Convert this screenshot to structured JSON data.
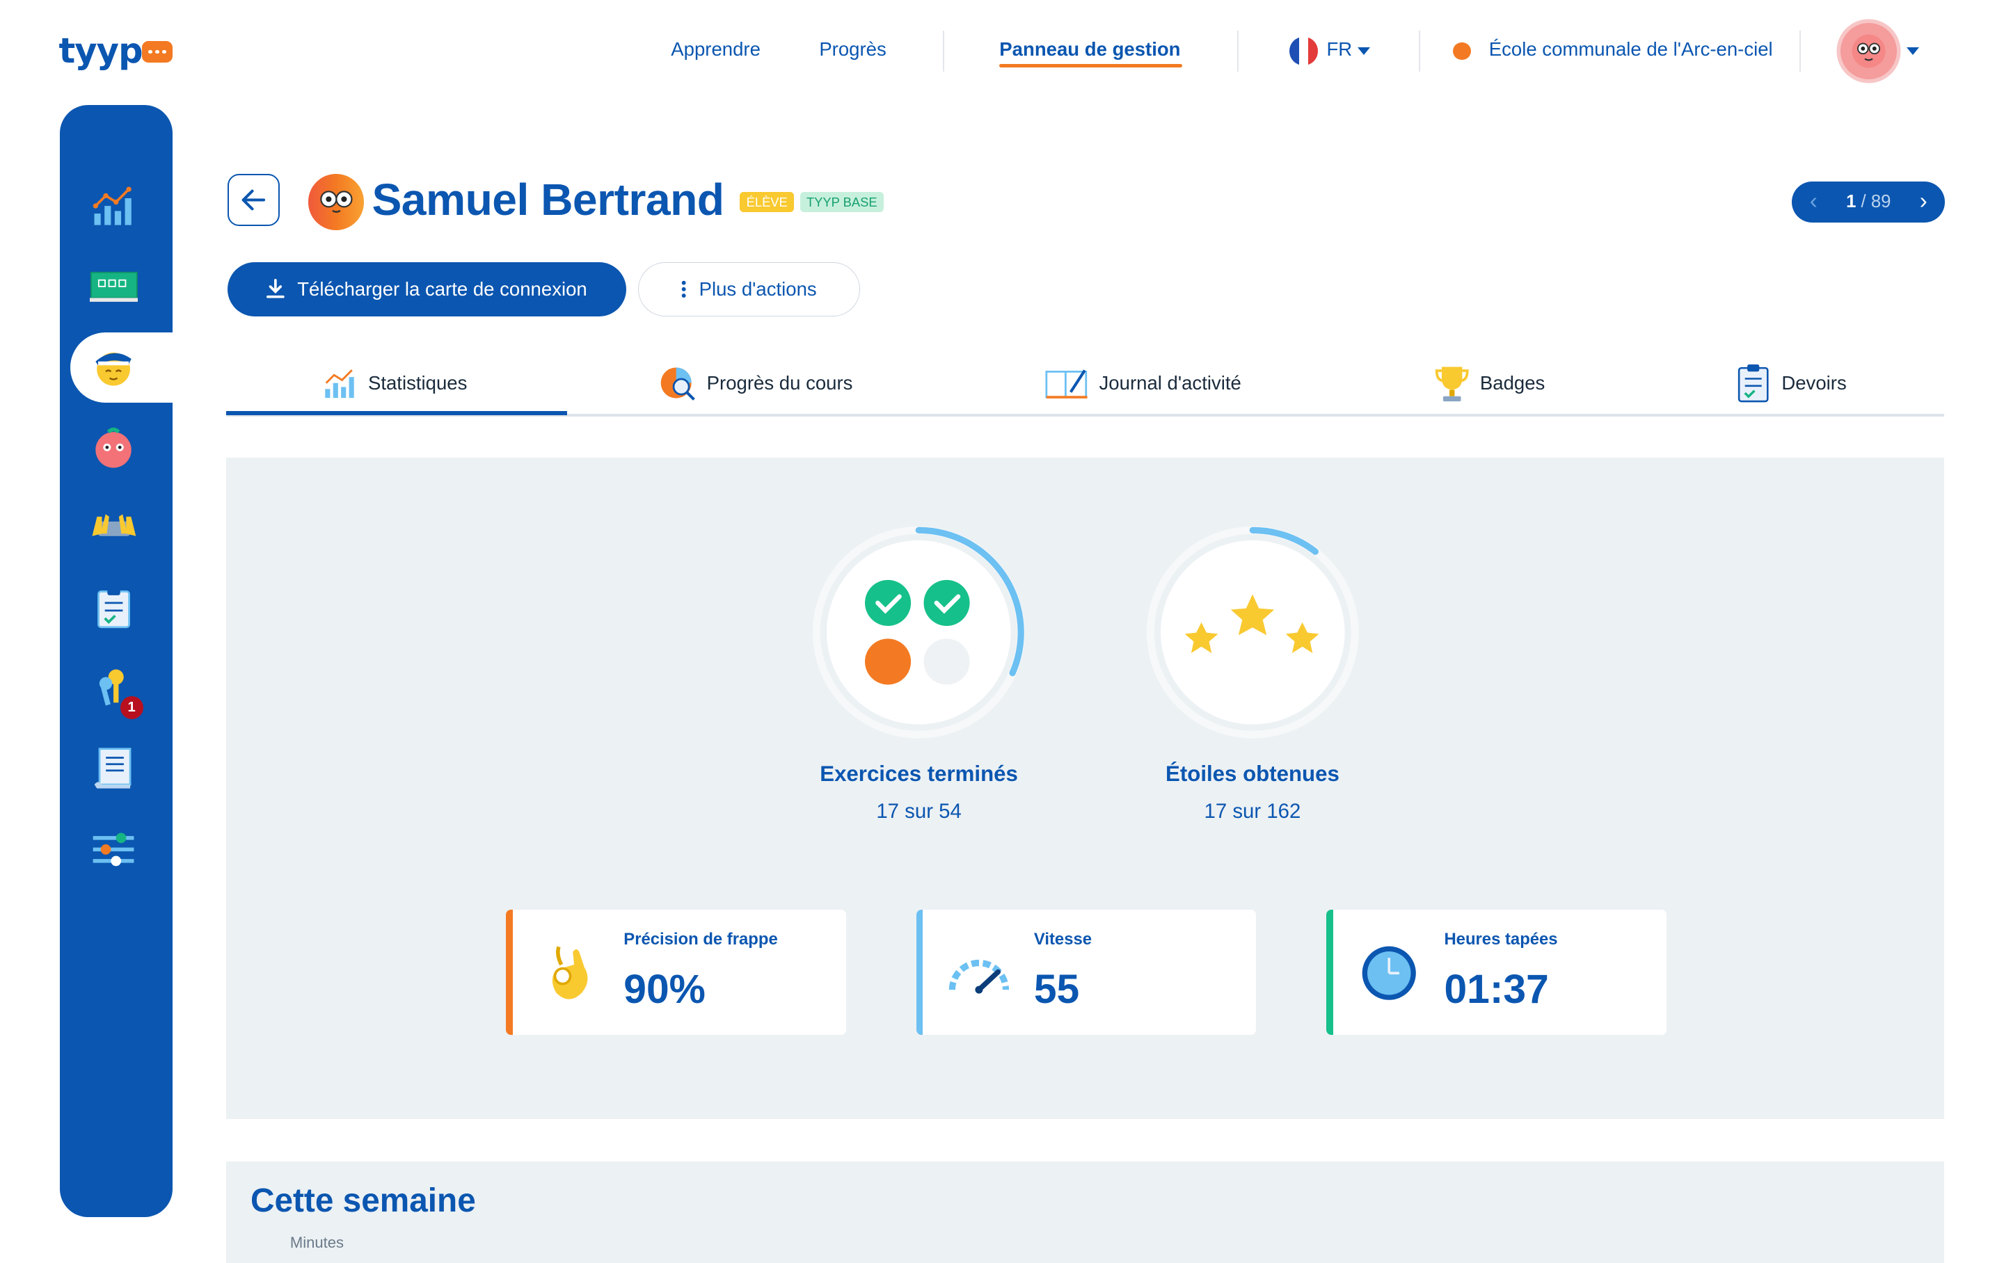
{
  "brand": {
    "logo": "tyyp"
  },
  "nav": {
    "learn": "Apprendre",
    "progress": "Progrès",
    "dashboard": "Panneau de gestion",
    "language": "FR",
    "school": "École communale de l'Arc-en-ciel"
  },
  "student": {
    "name": "Samuel Bertrand",
    "role_tag": "ÉLÈVE",
    "plan_tag": "TYYP BASE"
  },
  "pager": {
    "current": "1",
    "total": "/ 89"
  },
  "actions": {
    "download": "Télécharger la carte de connexion",
    "more": "Plus d'actions"
  },
  "tabs": [
    {
      "label": "Statistiques",
      "icon": "chart-icon"
    },
    {
      "label": "Progrès du cours",
      "icon": "pie-magnifier-icon"
    },
    {
      "label": "Journal d'activité",
      "icon": "notebook-icon"
    },
    {
      "label": "Badges",
      "icon": "trophy-icon"
    },
    {
      "label": "Devoirs",
      "icon": "clipboard-icon"
    }
  ],
  "stats": {
    "exercises": {
      "label": "Exercices terminés",
      "value": "17 sur 54",
      "fraction": 0.315
    },
    "stars": {
      "label": "Étoiles obtenues",
      "value": "17 sur 162",
      "fraction": 0.105
    }
  },
  "cards": [
    {
      "title": "Précision de frappe",
      "value": "90%",
      "accent": "#f37a22",
      "icon": "ok-hand-icon"
    },
    {
      "title": "Vitesse",
      "value": "55",
      "accent": "#6cc0f2",
      "icon": "speedometer-icon"
    },
    {
      "title": "Heures tapées",
      "value": "01:37",
      "accent": "#16c08a",
      "icon": "clock-icon"
    }
  ],
  "week": {
    "title": "Cette semaine",
    "axis_label": "Minutes"
  },
  "sidebar": {
    "items": [
      "chart-icon",
      "classroom-icon",
      "student-icon",
      "avatar-icon",
      "keyboard-hands-icon",
      "clipboard-icon",
      "keys-icon",
      "document-icon",
      "settings-sliders-icon"
    ],
    "keys_badge": "1"
  },
  "colors": {
    "primary": "#0b56b0",
    "accent": "#f37a22",
    "panel": "#ecf1f4",
    "green": "#16c08a"
  }
}
